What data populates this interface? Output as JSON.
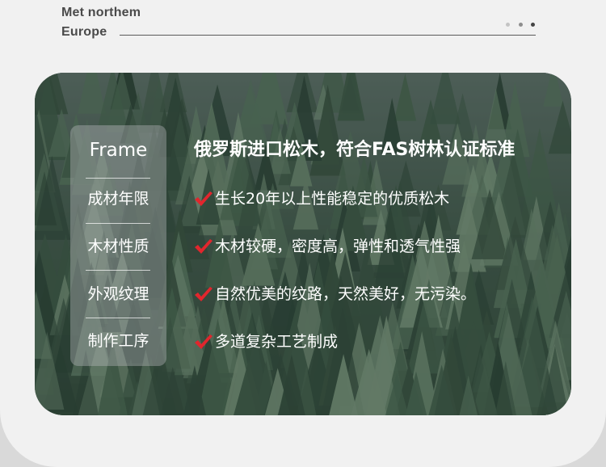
{
  "brand": {
    "line1": "Met northem",
    "line2": "Europe"
  },
  "colors": {
    "dot_light": "#c4c4c4",
    "dot_mid": "#8e8e8e",
    "dot_dark": "#444444",
    "check_red": "#e1262d",
    "rule": "#5a5a5a"
  },
  "panel": {
    "title": "Frame",
    "labels": [
      "成材年限",
      "木材性质",
      "外观纹理",
      "制作工序"
    ]
  },
  "headline": "俄罗斯进口松木，符合FAS树林认证标准",
  "features": [
    "生长20年以上性能稳定的优质松木",
    "木材较硬，密度高，弹性和透气性强",
    "自然优美的纹路，天然美好，无污染。",
    "多道复杂工艺制成"
  ],
  "icons": {
    "check": "check-icon",
    "pager": "pager-dots-icon"
  }
}
